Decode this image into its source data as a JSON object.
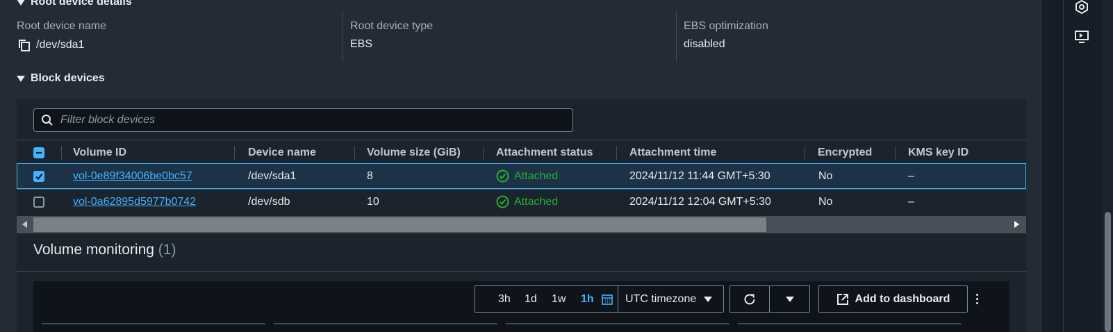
{
  "root_details": {
    "header": "Root device details",
    "name_label": "Root device name",
    "name_value": "/dev/sda1",
    "type_label": "Root device type",
    "type_value": "EBS",
    "ebs_label": "EBS optimization",
    "ebs_value": "disabled"
  },
  "block_devices": {
    "header": "Block devices",
    "filter_placeholder": "Filter block devices",
    "columns": [
      "Volume ID",
      "Device name",
      "Volume size (GiB)",
      "Attachment status",
      "Attachment time",
      "Encrypted",
      "KMS key ID"
    ],
    "rows": [
      {
        "selected": true,
        "volume_id": "vol-0e89f34006be0bc57",
        "device": "/dev/sda1",
        "size": "8",
        "status": "Attached",
        "time": "2024/11/12 11:44 GMT+5:30",
        "encrypted": "No",
        "kms": "–"
      },
      {
        "selected": false,
        "volume_id": "vol-0a62895d5977b0742",
        "device": "/dev/sdb",
        "size": "10",
        "status": "Attached",
        "time": "2024/11/12 12:04 GMT+5:30",
        "encrypted": "No",
        "kms": "–"
      }
    ]
  },
  "volume_monitoring": {
    "title": "Volume monitoring",
    "count": "(1)",
    "ranges": [
      "3h",
      "1d",
      "1w",
      "1h"
    ],
    "selected_range": "1h",
    "timezone": "UTC timezone",
    "add_dashboard": "Add to dashboard"
  },
  "colors": {
    "accent": "#42b4ff",
    "success": "#29ad32",
    "background": "#232b37"
  }
}
